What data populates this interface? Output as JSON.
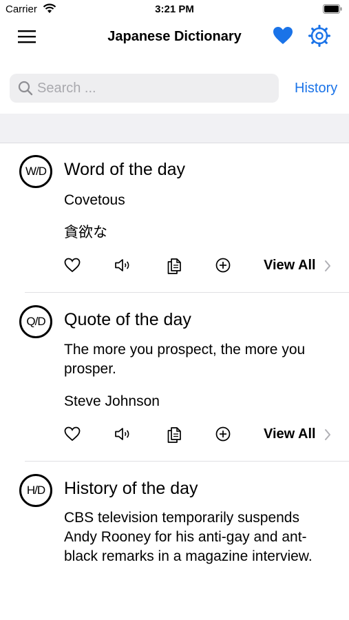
{
  "status_bar": {
    "carrier": "Carrier",
    "time": "3:21 PM"
  },
  "header": {
    "title": "Japanese Dictionary"
  },
  "search": {
    "placeholder": "Search ...",
    "value": "",
    "history_label": "History"
  },
  "cards": [
    {
      "badge": "W/D",
      "title": "Word of the day",
      "lines": [
        "Covetous",
        "貪欲な"
      ],
      "view_all": "View All"
    },
    {
      "badge": "Q/D",
      "title": "Quote of the day",
      "quote": "The more you prospect, the more you prosper.",
      "author": "Steve Johnson",
      "view_all": "View All"
    },
    {
      "badge": "H/D",
      "title": "History of the day",
      "text": "CBS television temporarily suspends Andy Rooney for his anti-gay and ant-black remarks in a magazine interview."
    }
  ],
  "icons": {
    "menu": "hamburger-menu-icon",
    "favorite": "heart-filled-icon",
    "settings": "gear-icon",
    "search": "search-icon",
    "actions": [
      "heart-outline-icon",
      "speaker-icon",
      "copy-icon",
      "add-circle-icon"
    ],
    "chevron": "chevron-right-icon"
  },
  "colors": {
    "accent": "#1a73e8",
    "heart": "#1a73e8"
  }
}
